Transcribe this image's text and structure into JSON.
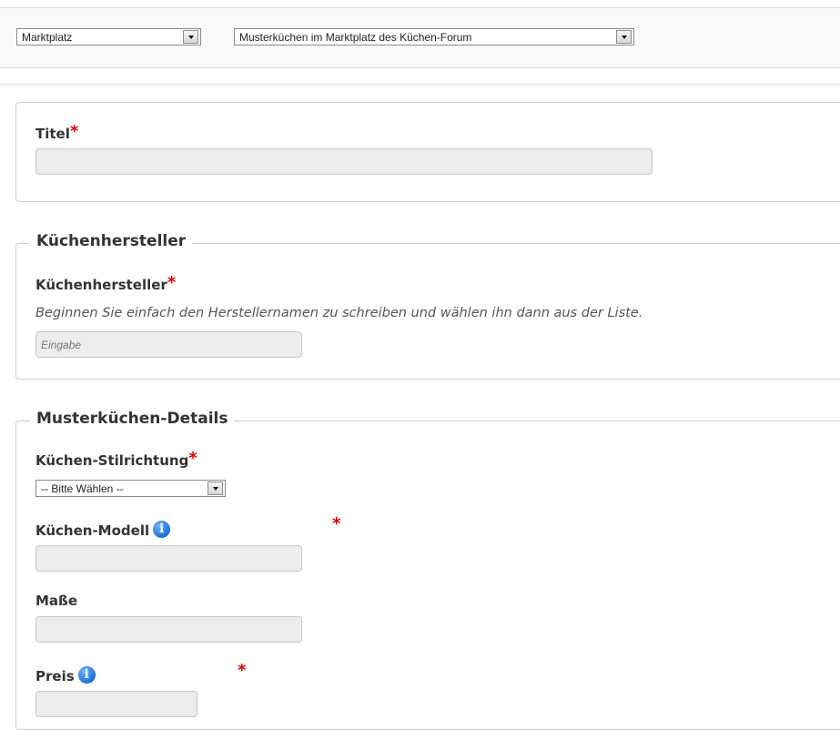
{
  "toolbar": {
    "category_select": {
      "value": "Marktplatz"
    },
    "subcategory_select": {
      "value": "Musterküchen im Marktplatz des Küchen-Forum"
    }
  },
  "title_section": {
    "label": "Titel",
    "required_mark": "*",
    "input_value": ""
  },
  "manufacturer_section": {
    "legend": "Küchenhersteller",
    "label": "Küchenhersteller",
    "required_mark": "*",
    "hint": "Beginnen Sie einfach den Herstellernamen zu schreiben und wählen ihn dann aus der Liste.",
    "input_placeholder": "Eingabe"
  },
  "details_section": {
    "legend": "Musterküchen-Details",
    "style": {
      "label": "Küchen-Stilrichtung",
      "required_mark": "*",
      "select_value": "-- Bitte Wählen --"
    },
    "model": {
      "label": "Küchen-Modell",
      "info_icon": "i",
      "required_mark": "*"
    },
    "dimensions": {
      "label": "Maße"
    },
    "price": {
      "label": "Preis",
      "info_icon": "i",
      "required_mark": "*"
    }
  },
  "colors": {
    "required": "#dd0000",
    "info_icon": "#1a6fd6",
    "input_bg": "#ececec"
  }
}
